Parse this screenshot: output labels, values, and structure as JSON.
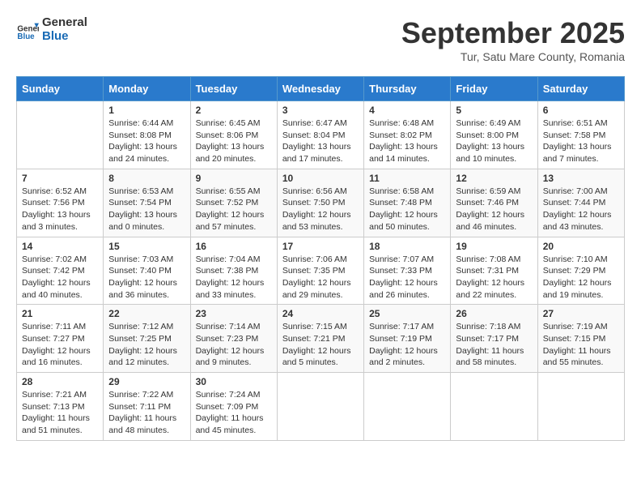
{
  "header": {
    "logo": {
      "line1": "General",
      "line2": "Blue"
    },
    "title": "September 2025",
    "location": "Tur, Satu Mare County, Romania"
  },
  "weekdays": [
    "Sunday",
    "Monday",
    "Tuesday",
    "Wednesday",
    "Thursday",
    "Friday",
    "Saturday"
  ],
  "weeks": [
    [
      {
        "day": "",
        "content": ""
      },
      {
        "day": "1",
        "content": "Sunrise: 6:44 AM\nSunset: 8:08 PM\nDaylight: 13 hours and 24 minutes."
      },
      {
        "day": "2",
        "content": "Sunrise: 6:45 AM\nSunset: 8:06 PM\nDaylight: 13 hours and 20 minutes."
      },
      {
        "day": "3",
        "content": "Sunrise: 6:47 AM\nSunset: 8:04 PM\nDaylight: 13 hours and 17 minutes."
      },
      {
        "day": "4",
        "content": "Sunrise: 6:48 AM\nSunset: 8:02 PM\nDaylight: 13 hours and 14 minutes."
      },
      {
        "day": "5",
        "content": "Sunrise: 6:49 AM\nSunset: 8:00 PM\nDaylight: 13 hours and 10 minutes."
      },
      {
        "day": "6",
        "content": "Sunrise: 6:51 AM\nSunset: 7:58 PM\nDaylight: 13 hours and 7 minutes."
      }
    ],
    [
      {
        "day": "7",
        "content": "Sunrise: 6:52 AM\nSunset: 7:56 PM\nDaylight: 13 hours and 3 minutes."
      },
      {
        "day": "8",
        "content": "Sunrise: 6:53 AM\nSunset: 7:54 PM\nDaylight: 13 hours and 0 minutes."
      },
      {
        "day": "9",
        "content": "Sunrise: 6:55 AM\nSunset: 7:52 PM\nDaylight: 12 hours and 57 minutes."
      },
      {
        "day": "10",
        "content": "Sunrise: 6:56 AM\nSunset: 7:50 PM\nDaylight: 12 hours and 53 minutes."
      },
      {
        "day": "11",
        "content": "Sunrise: 6:58 AM\nSunset: 7:48 PM\nDaylight: 12 hours and 50 minutes."
      },
      {
        "day": "12",
        "content": "Sunrise: 6:59 AM\nSunset: 7:46 PM\nDaylight: 12 hours and 46 minutes."
      },
      {
        "day": "13",
        "content": "Sunrise: 7:00 AM\nSunset: 7:44 PM\nDaylight: 12 hours and 43 minutes."
      }
    ],
    [
      {
        "day": "14",
        "content": "Sunrise: 7:02 AM\nSunset: 7:42 PM\nDaylight: 12 hours and 40 minutes."
      },
      {
        "day": "15",
        "content": "Sunrise: 7:03 AM\nSunset: 7:40 PM\nDaylight: 12 hours and 36 minutes."
      },
      {
        "day": "16",
        "content": "Sunrise: 7:04 AM\nSunset: 7:38 PM\nDaylight: 12 hours and 33 minutes."
      },
      {
        "day": "17",
        "content": "Sunrise: 7:06 AM\nSunset: 7:35 PM\nDaylight: 12 hours and 29 minutes."
      },
      {
        "day": "18",
        "content": "Sunrise: 7:07 AM\nSunset: 7:33 PM\nDaylight: 12 hours and 26 minutes."
      },
      {
        "day": "19",
        "content": "Sunrise: 7:08 AM\nSunset: 7:31 PM\nDaylight: 12 hours and 22 minutes."
      },
      {
        "day": "20",
        "content": "Sunrise: 7:10 AM\nSunset: 7:29 PM\nDaylight: 12 hours and 19 minutes."
      }
    ],
    [
      {
        "day": "21",
        "content": "Sunrise: 7:11 AM\nSunset: 7:27 PM\nDaylight: 12 hours and 16 minutes."
      },
      {
        "day": "22",
        "content": "Sunrise: 7:12 AM\nSunset: 7:25 PM\nDaylight: 12 hours and 12 minutes."
      },
      {
        "day": "23",
        "content": "Sunrise: 7:14 AM\nSunset: 7:23 PM\nDaylight: 12 hours and 9 minutes."
      },
      {
        "day": "24",
        "content": "Sunrise: 7:15 AM\nSunset: 7:21 PM\nDaylight: 12 hours and 5 minutes."
      },
      {
        "day": "25",
        "content": "Sunrise: 7:17 AM\nSunset: 7:19 PM\nDaylight: 12 hours and 2 minutes."
      },
      {
        "day": "26",
        "content": "Sunrise: 7:18 AM\nSunset: 7:17 PM\nDaylight: 11 hours and 58 minutes."
      },
      {
        "day": "27",
        "content": "Sunrise: 7:19 AM\nSunset: 7:15 PM\nDaylight: 11 hours and 55 minutes."
      }
    ],
    [
      {
        "day": "28",
        "content": "Sunrise: 7:21 AM\nSunset: 7:13 PM\nDaylight: 11 hours and 51 minutes."
      },
      {
        "day": "29",
        "content": "Sunrise: 7:22 AM\nSunset: 7:11 PM\nDaylight: 11 hours and 48 minutes."
      },
      {
        "day": "30",
        "content": "Sunrise: 7:24 AM\nSunset: 7:09 PM\nDaylight: 11 hours and 45 minutes."
      },
      {
        "day": "",
        "content": ""
      },
      {
        "day": "",
        "content": ""
      },
      {
        "day": "",
        "content": ""
      },
      {
        "day": "",
        "content": ""
      }
    ]
  ]
}
